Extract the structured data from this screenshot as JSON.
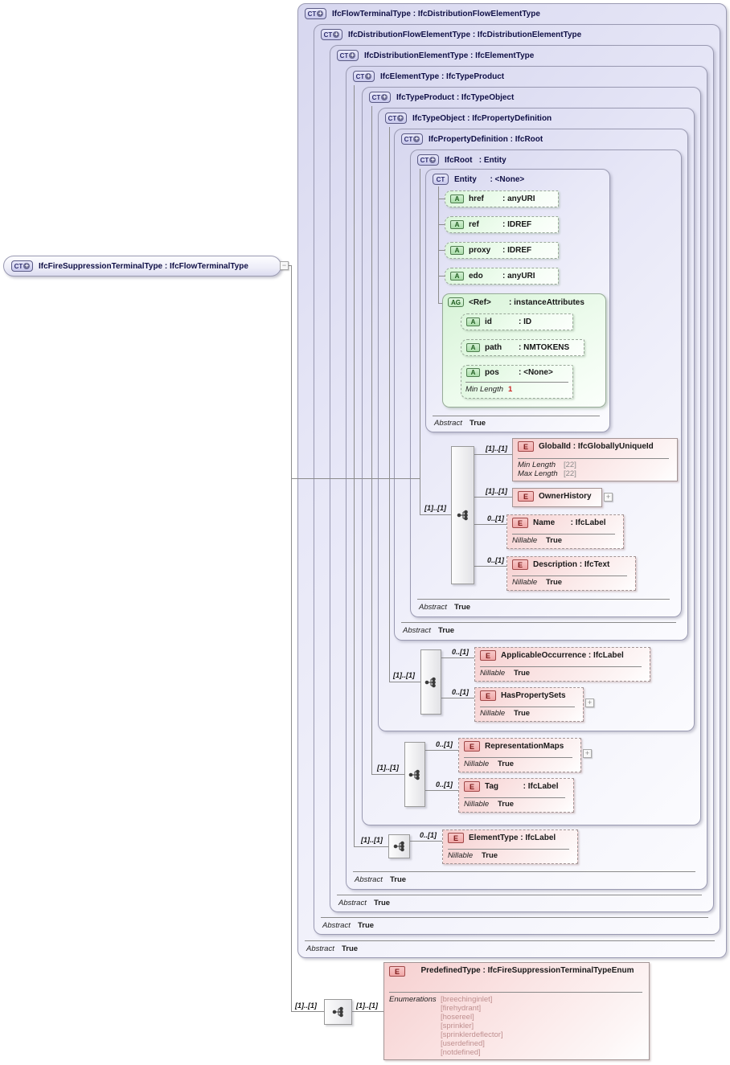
{
  "icons": {
    "ct": "CT",
    "plus": "+",
    "attr": "A",
    "attr_group": "AG",
    "element": "E",
    "expand": "+",
    "collapse": "−"
  },
  "root": {
    "title": "IfcFireSuppressionTerminalType : IfcFlowTerminalType"
  },
  "hierarchy": [
    {
      "title": "IfcFlowTerminalType : IfcDistributionFlowElementType",
      "abstract_label": "Abstract",
      "abstract_value": "True"
    },
    {
      "title": "IfcDistributionFlowElementType : IfcDistributionElementType",
      "abstract_label": "Abstract",
      "abstract_value": "True"
    },
    {
      "title": "IfcDistributionElementType : IfcElementType",
      "abstract_label": "Abstract",
      "abstract_value": "True"
    },
    {
      "title": "IfcElementType : IfcTypeProduct",
      "abstract_label": "Abstract",
      "abstract_value": "True"
    },
    {
      "title": "IfcTypeProduct : IfcTypeObject"
    },
    {
      "title": "IfcTypeObject : IfcPropertyDefinition"
    },
    {
      "title": "IfcPropertyDefinition : IfcRoot",
      "abstract_label": "Abstract",
      "abstract_value": "True"
    },
    {
      "title": "IfcRoot   : Entity",
      "abstract_label": "Abstract",
      "abstract_value": "True"
    }
  ],
  "entity": {
    "title": "Entity      : <None>",
    "abstract_label": "Abstract",
    "abstract_value": "True",
    "attributes": [
      {
        "name": "href",
        "type": ": anyURI"
      },
      {
        "name": "ref",
        "type": ": IDREF"
      },
      {
        "name": "proxy",
        "type": ": IDREF"
      },
      {
        "name": "edo",
        "type": ": anyURI"
      }
    ],
    "ref_group": {
      "title": "<Ref>        : instanceAttributes",
      "attributes": [
        {
          "name": "id",
          "type": ": ID"
        },
        {
          "name": "path",
          "type": ": NMTOKENS"
        },
        {
          "name": "pos",
          "type": ": <None>"
        }
      ],
      "pos_facet_label": "Min Length",
      "pos_facet_value": "1"
    }
  },
  "cardinalities": {
    "one_one": "[1]..[1]",
    "zero_one": "0..[1]"
  },
  "elements": {
    "global_id": {
      "title": "GlobalId : IfcGloballyUniqueId",
      "facet1_label": "Min Length",
      "facet1_value": "[22]",
      "facet2_label": "Max Length",
      "facet2_value": "[22]"
    },
    "owner_history": {
      "title": "OwnerHistory"
    },
    "name": {
      "title": "Name       : IfcLabel",
      "nillable_label": "Nillable",
      "nillable_value": "True"
    },
    "description": {
      "title": "Description : IfcText",
      "nillable_label": "Nillable",
      "nillable_value": "True"
    },
    "applicable_occurrence": {
      "title": "ApplicableOccurrence : IfcLabel",
      "nillable_label": "Nillable",
      "nillable_value": "True"
    },
    "has_property_sets": {
      "title": "HasPropertySets",
      "nillable_label": "Nillable",
      "nillable_value": "True"
    },
    "representation_maps": {
      "title": "RepresentationMaps",
      "nillable_label": "Nillable",
      "nillable_value": "True"
    },
    "tag": {
      "title": "Tag           : IfcLabel",
      "nillable_label": "Nillable",
      "nillable_value": "True"
    },
    "element_type": {
      "title": "ElementType : IfcLabel",
      "nillable_label": "Nillable",
      "nillable_value": "True"
    },
    "predefined_type": {
      "title": "PredefinedType : IfcFireSuppressionTerminalTypeEnum",
      "enumerations_label": "Enumerations",
      "enumerations": [
        "[breechinginlet]",
        "[firehydrant]",
        "[hosereel]",
        "[sprinkler]",
        "[sprinklerdeflector]",
        "[userdefined]",
        "[notdefined]"
      ]
    }
  }
}
